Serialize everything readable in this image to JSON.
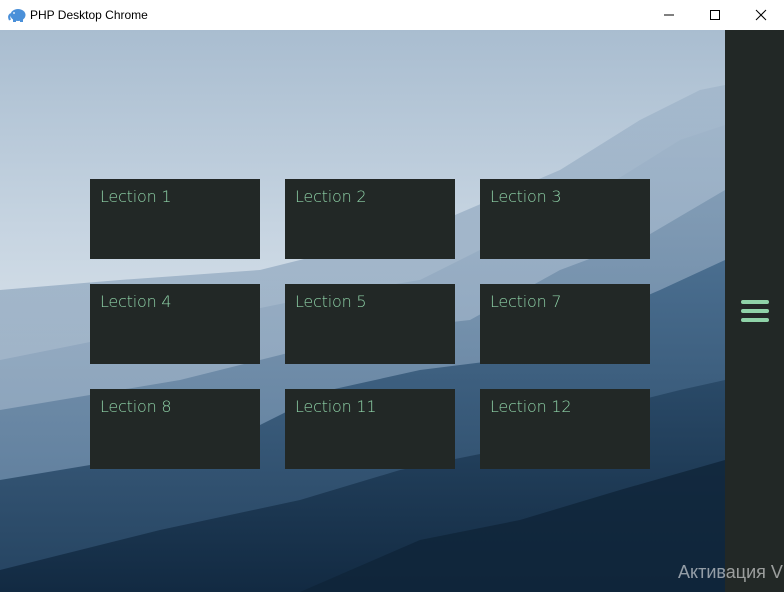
{
  "window": {
    "title": "PHP Desktop Chrome",
    "controls": [
      "minimize-icon",
      "maximize-icon",
      "close-icon"
    ]
  },
  "lections": [
    {
      "label": "Lection 1"
    },
    {
      "label": "Lection 2"
    },
    {
      "label": "Lection 3"
    },
    {
      "label": "Lection 4"
    },
    {
      "label": "Lection 5"
    },
    {
      "label": "Lection 7"
    },
    {
      "label": "Lection 8"
    },
    {
      "label": "Lection 11"
    },
    {
      "label": "Lection 12"
    }
  ],
  "side_panel": {
    "menu_icon": "hamburger-icon"
  },
  "watermark": {
    "text": "Активация V"
  },
  "colors": {
    "card_bg": "#222826",
    "accent": "#8fd3a8",
    "sky_top": "#a9bdd0",
    "mist": "#d9e2ea",
    "deep_mountain": "#1d3a55"
  }
}
